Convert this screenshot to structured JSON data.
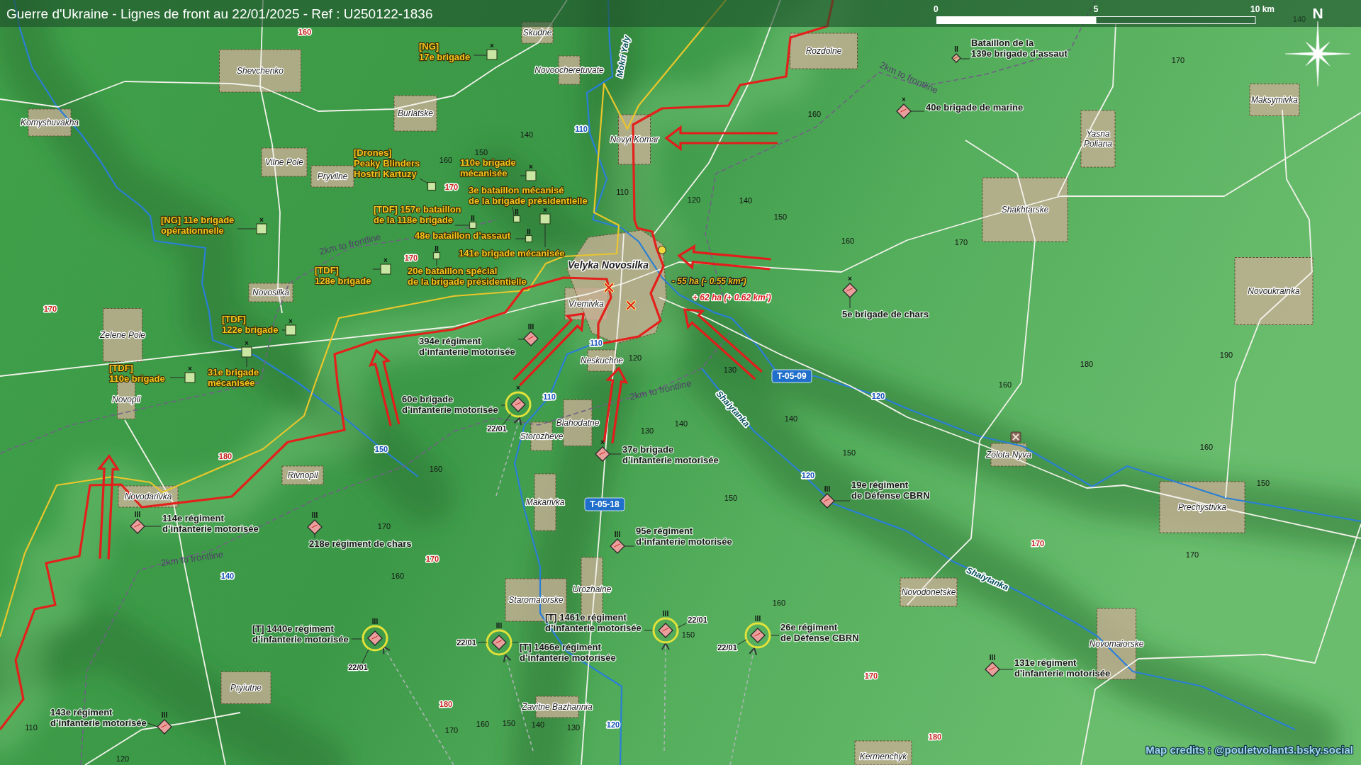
{
  "title": "Guerre d'Ukraine - Lignes de front au 22/01/2025 - Ref : U250122-1836",
  "scale_bar": {
    "labels": [
      "0",
      "5",
      "10 km"
    ]
  },
  "compass": {
    "label": "N"
  },
  "towns": [
    {
      "name": "Skudne",
      "kind": "village"
    },
    {
      "name": "Rozdolne",
      "kind": "village"
    },
    {
      "name": "Shevchenko",
      "kind": "village"
    },
    {
      "name": "Novoocheretuvate",
      "kind": "village"
    },
    {
      "name": "Maksymivka",
      "kind": "village"
    },
    {
      "name": "Burlatske",
      "kind": "village"
    },
    {
      "name": "Komyshuvakha",
      "kind": "village"
    },
    {
      "name": "Novyi Komar",
      "kind": "village"
    },
    {
      "name": "Yasna Poliana",
      "kind": "village"
    },
    {
      "name": "Vilne Pole",
      "kind": "village"
    },
    {
      "name": "Pryvilne",
      "kind": "village"
    },
    {
      "name": "Shakhtarske",
      "kind": "village"
    },
    {
      "name": "Velyka Novosilka",
      "kind": "city"
    },
    {
      "name": "Novosilka",
      "kind": "village"
    },
    {
      "name": "Novoukrainka",
      "kind": "village"
    },
    {
      "name": "Vremivka",
      "kind": "village"
    },
    {
      "name": "Zelene Pole",
      "kind": "village"
    },
    {
      "name": "Neskuchne",
      "kind": "village"
    },
    {
      "name": "Novopil",
      "kind": "village"
    },
    {
      "name": "Blahodatne",
      "kind": "village"
    },
    {
      "name": "Storozheve",
      "kind": "village"
    },
    {
      "name": "Zolota Nyva",
      "kind": "village"
    },
    {
      "name": "Rivnopil",
      "kind": "village"
    },
    {
      "name": "Novodarivka",
      "kind": "village"
    },
    {
      "name": "Makarivka",
      "kind": "village"
    },
    {
      "name": "Prechystivka",
      "kind": "village"
    },
    {
      "name": "Urozhaine",
      "kind": "village"
    },
    {
      "name": "Novodonetske",
      "kind": "village"
    },
    {
      "name": "Staromaiorske",
      "kind": "village"
    },
    {
      "name": "Novomaiorske",
      "kind": "village"
    },
    {
      "name": "Pryiutne",
      "kind": "village"
    },
    {
      "name": "Zavitne Bazhannia",
      "kind": "village"
    },
    {
      "name": "Kermenchyk",
      "kind": "village"
    }
  ],
  "elevation_labels": [
    {
      "text": "140",
      "kind": "contour"
    },
    {
      "text": "160",
      "kind": "spot"
    },
    {
      "text": "170",
      "kind": "contour"
    },
    {
      "text": "160",
      "kind": "contour"
    },
    {
      "text": "110",
      "kind": "water"
    },
    {
      "text": "140",
      "kind": "contour"
    },
    {
      "text": "150",
      "kind": "contour"
    },
    {
      "text": "160",
      "kind": "contour"
    },
    {
      "text": "170",
      "kind": "spot"
    },
    {
      "text": "110",
      "kind": "contour"
    },
    {
      "text": "120",
      "kind": "contour"
    },
    {
      "text": "140",
      "kind": "contour"
    },
    {
      "text": "150",
      "kind": "contour"
    },
    {
      "text": "160",
      "kind": "contour"
    },
    {
      "text": "170",
      "kind": "contour"
    },
    {
      "text": "170",
      "kind": "spot"
    },
    {
      "text": "170",
      "kind": "spot"
    },
    {
      "text": "110",
      "kind": "water"
    },
    {
      "text": "190",
      "kind": "contour"
    },
    {
      "text": "120",
      "kind": "contour"
    },
    {
      "text": "180",
      "kind": "contour"
    },
    {
      "text": "130",
      "kind": "contour"
    },
    {
      "text": "160",
      "kind": "contour"
    },
    {
      "text": "120",
      "kind": "water"
    },
    {
      "text": "110",
      "kind": "water"
    },
    {
      "text": "140",
      "kind": "contour"
    },
    {
      "text": "140",
      "kind": "contour"
    },
    {
      "text": "130",
      "kind": "contour"
    },
    {
      "text": "160",
      "kind": "contour"
    },
    {
      "text": "150",
      "kind": "water"
    },
    {
      "text": "150",
      "kind": "contour"
    },
    {
      "text": "180",
      "kind": "spot"
    },
    {
      "text": "160",
      "kind": "contour"
    },
    {
      "text": "120",
      "kind": "water"
    },
    {
      "text": "150",
      "kind": "contour"
    },
    {
      "text": "150",
      "kind": "contour"
    },
    {
      "text": "170",
      "kind": "contour"
    },
    {
      "text": "170",
      "kind": "spot"
    },
    {
      "text": "170",
      "kind": "contour"
    },
    {
      "text": "170",
      "kind": "spot"
    },
    {
      "text": "140",
      "kind": "water"
    },
    {
      "text": "160",
      "kind": "contour"
    },
    {
      "text": "160",
      "kind": "contour"
    },
    {
      "text": "150",
      "kind": "contour"
    },
    {
      "text": "170",
      "kind": "spot"
    },
    {
      "text": "180",
      "kind": "spot"
    },
    {
      "text": "160",
      "kind": "contour"
    },
    {
      "text": "150",
      "kind": "contour"
    },
    {
      "text": "140",
      "kind": "contour"
    },
    {
      "text": "130",
      "kind": "contour"
    },
    {
      "text": "120",
      "kind": "water"
    },
    {
      "text": "110",
      "kind": "contour"
    },
    {
      "text": "170",
      "kind": "contour"
    },
    {
      "text": "180",
      "kind": "spot"
    },
    {
      "text": "120",
      "kind": "contour"
    }
  ],
  "road_numbers": [
    "T-05-09",
    "T-05-18"
  ],
  "rivers": [
    "Mokri Yaly",
    "Shaiytanka",
    "Shaiytanka"
  ],
  "buffer_labels": [
    "2km to frontline",
    "2km to frontline",
    "2km to frontline",
    "2km to frontline"
  ],
  "area_changes": [
    {
      "text": "- 55 ha (- 0.55 km²)",
      "kind": "loss"
    },
    {
      "text": "+ 62 ha (+ 0.62 km²)",
      "kind": "gain"
    }
  ],
  "ukrainian_units": [
    {
      "kind": "brigade",
      "echelon": "×",
      "lines": [
        "[NG]",
        "17e brigade"
      ]
    },
    {
      "kind": "detachment",
      "lines": [
        "[Drones]",
        "Peaky Blinders",
        "Hostri Kartuzy"
      ]
    },
    {
      "kind": "brigade",
      "echelon": "×",
      "lines": [
        "110e brigade",
        "mécanisée"
      ]
    },
    {
      "kind": "battalion",
      "echelon": "II",
      "lines": [
        "3e bataillon mécanisé",
        "de la brigade présidentielle"
      ]
    },
    {
      "kind": "battalion",
      "echelon": "II",
      "lines": [
        "[TDF] 157e bataillon",
        "de la 118e brigade"
      ]
    },
    {
      "kind": "brigade",
      "echelon": "×",
      "lines": [
        "[NG] 11e brigade",
        "opérationnelle"
      ]
    },
    {
      "kind": "battalion",
      "echelon": "II",
      "lines": [
        "48e bataillon d’assaut"
      ]
    },
    {
      "kind": "brigade",
      "echelon": "×",
      "lines": [
        "141e brigade mécanisée"
      ]
    },
    {
      "kind": "brigade",
      "echelon": "×",
      "lines": [
        "[TDF]",
        "128e brigade"
      ]
    },
    {
      "kind": "battalion",
      "echelon": "II",
      "lines": [
        "20e bataillon spécial",
        "de la brigade présidentielle"
      ]
    },
    {
      "kind": "brigade",
      "echelon": "×",
      "lines": [
        "[TDF]",
        "122e brigade"
      ]
    },
    {
      "kind": "brigade",
      "echelon": "×",
      "lines": [
        "[TDF]",
        "110e brigade"
      ]
    },
    {
      "kind": "brigade",
      "echelon": "×",
      "lines": [
        "31e brigade",
        "mécanisée"
      ]
    }
  ],
  "russian_units": [
    {
      "kind": "battalion",
      "echelon": "II",
      "lines": [
        "Bataillon de la",
        "139e brigade d’assaut"
      ],
      "highlighted": false
    },
    {
      "kind": "brigade",
      "echelon": "×",
      "lines": [
        "40e brigade de marine"
      ],
      "highlighted": false
    },
    {
      "kind": "brigade",
      "echelon": "×",
      "lines": [
        "5e brigade de chars"
      ],
      "highlighted": false
    },
    {
      "kind": "regiment",
      "echelon": "III",
      "lines": [
        "394e régiment",
        "d’infanterie motorisée"
      ],
      "highlighted": false
    },
    {
      "kind": "brigade",
      "echelon": "×",
      "lines": [
        "60e brigade",
        "d’infanterie motorisée"
      ],
      "highlighted": true,
      "date": "22/01"
    },
    {
      "kind": "brigade",
      "echelon": "×",
      "lines": [
        "37e brigade",
        "d’infanterie motorisée"
      ],
      "highlighted": false
    },
    {
      "kind": "regiment",
      "echelon": "III",
      "lines": [
        "19e régiment",
        "de Défense CBRN"
      ],
      "highlighted": false
    },
    {
      "kind": "regiment",
      "echelon": "III",
      "lines": [
        "114e régiment",
        "d’infanterie motorisée"
      ],
      "highlighted": false
    },
    {
      "kind": "regiment",
      "echelon": "III",
      "lines": [
        "218e régiment de chars"
      ],
      "highlighted": false
    },
    {
      "kind": "regiment",
      "echelon": "III",
      "lines": [
        "95e régiment",
        "d’infanterie motorisée"
      ],
      "highlighted": false
    },
    {
      "kind": "regiment",
      "echelon": "III",
      "lines": [
        "[T] 1440e régiment",
        "d’infanterie motorisée"
      ],
      "highlighted": true,
      "date": "22/01"
    },
    {
      "kind": "regiment",
      "echelon": "III",
      "lines": [
        "[T] 1461e régiment",
        "d’infanterie motorisée"
      ],
      "highlighted": true,
      "date": "22/01"
    },
    {
      "kind": "regiment",
      "echelon": "III",
      "lines": [
        "[T] 1466e régiment",
        "d’infanterie motorisée"
      ],
      "highlighted": true,
      "date": "22/01"
    },
    {
      "kind": "regiment",
      "echelon": "III",
      "lines": [
        "26e régiment",
        "de Défense CBRN"
      ],
      "highlighted": true,
      "date": "22/01"
    },
    {
      "kind": "regiment",
      "echelon": "III",
      "lines": [
        "131e régiment",
        "d'infanterie motorisée"
      ],
      "highlighted": false
    },
    {
      "kind": "regiment",
      "echelon": "III",
      "lines": [
        "143e régiment",
        "d’infanterie motorisée"
      ],
      "highlighted": false
    }
  ],
  "credits": "Map credits : @pouletvolant3.bsky.social"
}
